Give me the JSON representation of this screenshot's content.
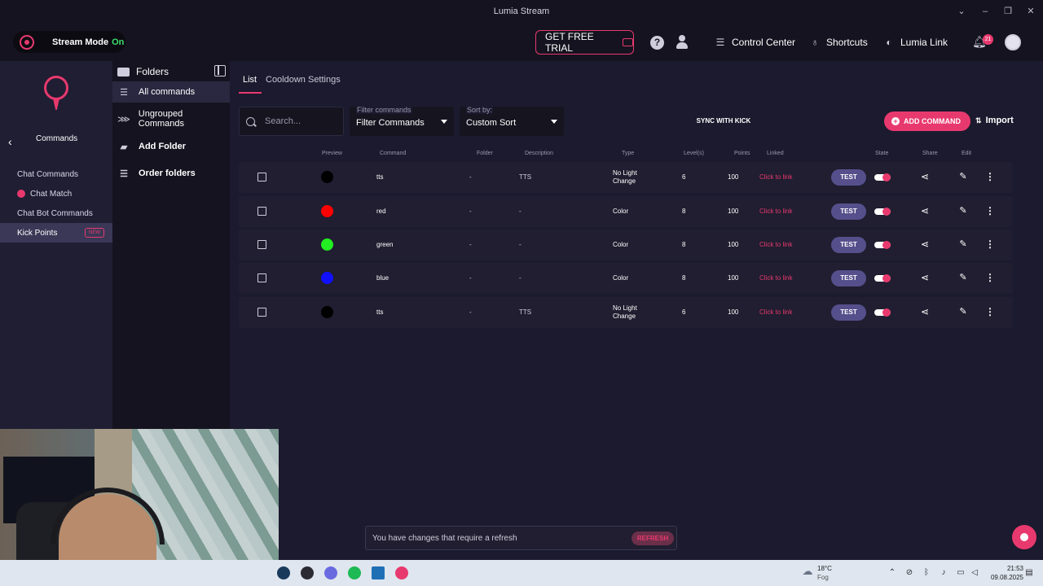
{
  "window": {
    "title": "Lumia Stream"
  },
  "topbar": {
    "stream_mode_label": "Stream Mode",
    "stream_mode_state": "On",
    "free_trial_label": "GET FREE TRIAL",
    "nav": [
      {
        "label": "Control Center",
        "icon": "sliders-icon"
      },
      {
        "label": "Shortcuts",
        "icon": "lightbulb-icon"
      },
      {
        "label": "Lumia Link",
        "icon": "link-icon"
      }
    ],
    "notification_count": "21"
  },
  "leftnav": {
    "section_title": "Commands",
    "items": [
      {
        "label": "Chat Commands"
      },
      {
        "label": "Chat Match"
      },
      {
        "label": "Chat Bot Commands"
      },
      {
        "label": "Kick Points",
        "badge": "NEW"
      }
    ]
  },
  "folders": {
    "title": "Folders",
    "items": [
      {
        "label": "All commands"
      },
      {
        "label": "Ungrouped Commands"
      },
      {
        "label": "Add Folder"
      },
      {
        "label": "Order folders"
      }
    ]
  },
  "main": {
    "tabs": [
      "List",
      "Cooldown Settings"
    ],
    "search_placeholder": "Search...",
    "filter": {
      "label": "Filter commands",
      "value": "Filter Commands"
    },
    "sort": {
      "label": "Sort by:",
      "value": "Custom Sort"
    },
    "sync_label": "SYNC WITH KICK",
    "add_label": "ADD COMMAND",
    "import_label": "Import",
    "columns": {
      "preview": "Preview",
      "command": "Command",
      "folder": "Folder",
      "description": "Description",
      "type": "Type",
      "levels": "Level(s)",
      "points": "Points",
      "linked": "Linked",
      "state": "State",
      "share": "Share",
      "edit": "Edit"
    },
    "rows": [
      {
        "color": "#000000",
        "command": "tts",
        "folder": "-",
        "description": "TTS",
        "type_line1": "No Light",
        "type_line2": "Change",
        "level": "6",
        "points": "100",
        "linked": "Click to link",
        "test": "TEST"
      },
      {
        "color": "#ff0000",
        "command": "red",
        "folder": "-",
        "description": "-",
        "type_line1": "Color",
        "type_line2": "",
        "level": "8",
        "points": "100",
        "linked": "Click to link",
        "test": "TEST"
      },
      {
        "color": "#22ee22",
        "command": "green",
        "folder": "-",
        "description": "-",
        "type_line1": "Color",
        "type_line2": "",
        "level": "8",
        "points": "100",
        "linked": "Click to link",
        "test": "TEST"
      },
      {
        "color": "#1010ff",
        "command": "blue",
        "folder": "-",
        "description": "-",
        "type_line1": "Color",
        "type_line2": "",
        "level": "8",
        "points": "100",
        "linked": "Click to link",
        "test": "TEST"
      },
      {
        "color": "#000000",
        "command": "tts",
        "folder": "-",
        "description": "TTS",
        "type_line1": "No Light",
        "type_line2": "Change",
        "level": "6",
        "points": "100",
        "linked": "Click to link",
        "test": "TEST"
      }
    ]
  },
  "refresh": {
    "message": "You have changes that require a refresh",
    "button": "REFRESH"
  },
  "taskbar": {
    "weather_temp": "18°C",
    "weather_desc": "Fog",
    "time": "21:53",
    "date": "09.08.2025"
  },
  "colors": {
    "accent": "#e8396e",
    "background": "#1c1a2e",
    "test_button": "#55508c"
  }
}
